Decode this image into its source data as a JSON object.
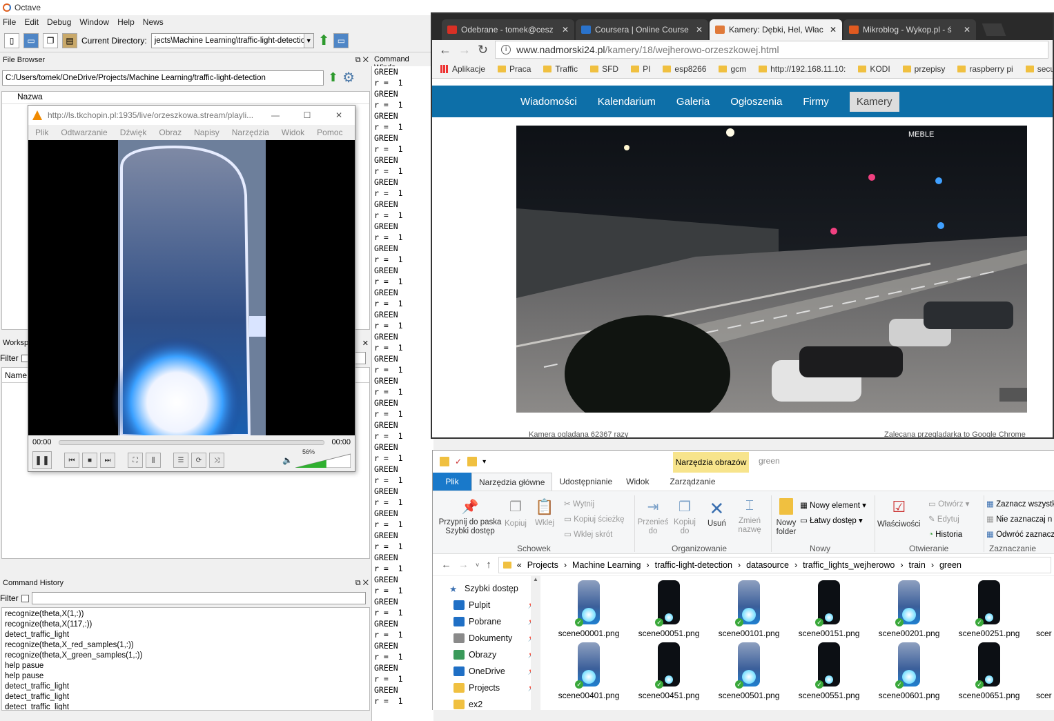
{
  "octave": {
    "title": "Octave",
    "menu": [
      "File",
      "Edit",
      "Debug",
      "Window",
      "Help",
      "News"
    ],
    "current_dir_label": "Current Directory:",
    "current_dir_value": "jects\\Machine Learning\\traffic-light-detection",
    "file_browser": {
      "title": "File Browser",
      "path": "C:/Users/tomek/OneDrive/Projects/Machine Learning/traffic-light-detection",
      "column": "Nazwa"
    },
    "workspace": {
      "title": "Workspa",
      "filter": "Filter",
      "column": "Name"
    },
    "command_history": {
      "title": "Command History",
      "filter": "Filter",
      "items": [
        "recognize(theta,X(1,:))",
        "recognize(theta,X(117,:))",
        "detect_traffic_light",
        "recognize(theta,X_red_samples(1,:))",
        "recognize(theta,X_green_samples(1,:))",
        "help pasue",
        "help pause",
        "detect_traffic_light",
        "detect_traffic_light",
        "detect_traffic_light"
      ]
    },
    "command_window": {
      "title": "Command Windo",
      "line_a": "GREEN",
      "line_b": "r =  1",
      "repeat": 29
    }
  },
  "vlc": {
    "title": "http://ls.tkchopin.pl:1935/live/orzeszkowa.stream/playli...",
    "menu": [
      "Plik",
      "Odtwarzanie",
      "Dźwięk",
      "Obraz",
      "Napisy",
      "Narzędzia",
      "Widok",
      "Pomoc"
    ],
    "time_start": "00:00",
    "time_end": "00:00",
    "volume": "56%",
    "volume_value": 0.56
  },
  "chrome": {
    "tabs": [
      {
        "label": "Odebrane - tomek@cesz",
        "icon": "gmail-icon",
        "color": "#d93025"
      },
      {
        "label": "Coursera | Online Course",
        "icon": "coursera-icon",
        "color": "#2a73cc"
      },
      {
        "label": "Kamery: Dębki, Hel, Włac",
        "icon": "kamery-icon",
        "color": "#e07a3a"
      },
      {
        "label": "Mikroblog - Wykop.pl - ś",
        "icon": "wykop-icon",
        "color": "#e05a20"
      }
    ],
    "url_host": "www.nadmorski24.pl",
    "url_path": "/kamery/18/wejherowo-orzeszkowej.html",
    "bookmarks": [
      "Aplikacje",
      "Praca",
      "Traffic",
      "SFD",
      "PI",
      "esp8266",
      "gcm",
      "http://192.168.11.10:",
      "KODI",
      "przepisy",
      "raspberry pi",
      "security"
    ],
    "site_nav": [
      "Wiadomości",
      "Kalendarium",
      "Galeria",
      "Ogłoszenia",
      "Firmy",
      "Kamery"
    ],
    "sign_text": "MEBLE",
    "footer_left": "Kamera oglądana 62367 razy",
    "footer_right": "Zalecana przeglądarka to Google Chrome"
  },
  "explorer": {
    "context_tab": "Narzędzia obrazów",
    "window_title": "green",
    "tabs": [
      "Plik",
      "Narzędzia główne",
      "Udostępnianie",
      "Widok",
      "Zarządzanie"
    ],
    "groups": {
      "schowek": {
        "title": "Schowek",
        "pin": "Przypnij do paska Szybki dostęp",
        "copy": "Kopiuj",
        "paste": "Wklej",
        "cut": "Wytnij",
        "copy_path": "Kopiuj ścieżkę",
        "paste_shortcut": "Wklej skrót"
      },
      "organizowanie": {
        "title": "Organizowanie",
        "move": "Przenieś do",
        "copy_to": "Kopiuj do",
        "delete": "Usuń",
        "rename": "Zmień nazwę"
      },
      "nowy": {
        "title": "Nowy",
        "new_folder": "Nowy folder",
        "new_element": "Nowy element",
        "easy_access": "Łatwy dostęp"
      },
      "otwieranie": {
        "title": "Otwieranie",
        "properties": "Właściwości",
        "open": "Otwórz",
        "edit": "Edytuj",
        "history": "Historia"
      },
      "zaznaczanie": {
        "title": "Zaznaczanie",
        "select_all": "Zaznacz wszystk",
        "select_none": "Nie zaznaczaj n",
        "invert": "Odwróć zaznacz"
      }
    },
    "breadcrumb": [
      "Projects",
      "Machine Learning",
      "traffic-light-detection",
      "datasource",
      "traffic_lights_wejherowo",
      "train",
      "green"
    ],
    "nav": [
      "Szybki dostęp",
      "Pulpit",
      "Pobrane",
      "Dokumenty",
      "Obrazy",
      "OneDrive",
      "Projects",
      "ex2"
    ],
    "files": [
      "scene00001.png",
      "scene00051.png",
      "scene00101.png",
      "scene00151.png",
      "scene00201.png",
      "scene00251.png",
      "scene00401.png",
      "scene00451.png",
      "scene00501.png",
      "scene00551.png",
      "scene00601.png",
      "scene00651.png"
    ],
    "file_cut": "scer"
  }
}
